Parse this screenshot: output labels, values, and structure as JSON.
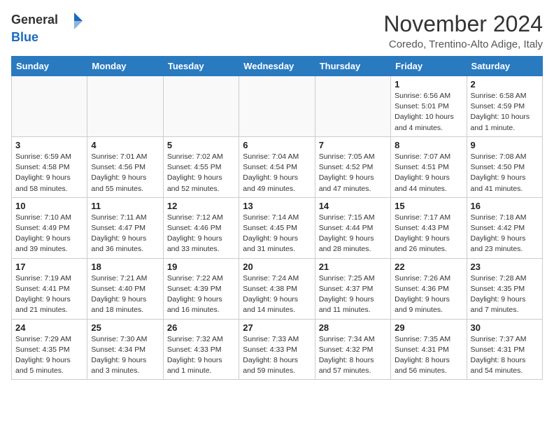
{
  "header": {
    "logo_general": "General",
    "logo_blue": "Blue",
    "month_title": "November 2024",
    "location": "Coredo, Trentino-Alto Adige, Italy"
  },
  "days_of_week": [
    "Sunday",
    "Monday",
    "Tuesday",
    "Wednesday",
    "Thursday",
    "Friday",
    "Saturday"
  ],
  "weeks": [
    [
      {
        "day": "",
        "info": "",
        "empty": true
      },
      {
        "day": "",
        "info": "",
        "empty": true
      },
      {
        "day": "",
        "info": "",
        "empty": true
      },
      {
        "day": "",
        "info": "",
        "empty": true
      },
      {
        "day": "",
        "info": "",
        "empty": true
      },
      {
        "day": "1",
        "info": "Sunrise: 6:56 AM\nSunset: 5:01 PM\nDaylight: 10 hours and 4 minutes.",
        "empty": false
      },
      {
        "day": "2",
        "info": "Sunrise: 6:58 AM\nSunset: 4:59 PM\nDaylight: 10 hours and 1 minute.",
        "empty": false
      }
    ],
    [
      {
        "day": "3",
        "info": "Sunrise: 6:59 AM\nSunset: 4:58 PM\nDaylight: 9 hours and 58 minutes.",
        "empty": false
      },
      {
        "day": "4",
        "info": "Sunrise: 7:01 AM\nSunset: 4:56 PM\nDaylight: 9 hours and 55 minutes.",
        "empty": false
      },
      {
        "day": "5",
        "info": "Sunrise: 7:02 AM\nSunset: 4:55 PM\nDaylight: 9 hours and 52 minutes.",
        "empty": false
      },
      {
        "day": "6",
        "info": "Sunrise: 7:04 AM\nSunset: 4:54 PM\nDaylight: 9 hours and 49 minutes.",
        "empty": false
      },
      {
        "day": "7",
        "info": "Sunrise: 7:05 AM\nSunset: 4:52 PM\nDaylight: 9 hours and 47 minutes.",
        "empty": false
      },
      {
        "day": "8",
        "info": "Sunrise: 7:07 AM\nSunset: 4:51 PM\nDaylight: 9 hours and 44 minutes.",
        "empty": false
      },
      {
        "day": "9",
        "info": "Sunrise: 7:08 AM\nSunset: 4:50 PM\nDaylight: 9 hours and 41 minutes.",
        "empty": false
      }
    ],
    [
      {
        "day": "10",
        "info": "Sunrise: 7:10 AM\nSunset: 4:49 PM\nDaylight: 9 hours and 39 minutes.",
        "empty": false
      },
      {
        "day": "11",
        "info": "Sunrise: 7:11 AM\nSunset: 4:47 PM\nDaylight: 9 hours and 36 minutes.",
        "empty": false
      },
      {
        "day": "12",
        "info": "Sunrise: 7:12 AM\nSunset: 4:46 PM\nDaylight: 9 hours and 33 minutes.",
        "empty": false
      },
      {
        "day": "13",
        "info": "Sunrise: 7:14 AM\nSunset: 4:45 PM\nDaylight: 9 hours and 31 minutes.",
        "empty": false
      },
      {
        "day": "14",
        "info": "Sunrise: 7:15 AM\nSunset: 4:44 PM\nDaylight: 9 hours and 28 minutes.",
        "empty": false
      },
      {
        "day": "15",
        "info": "Sunrise: 7:17 AM\nSunset: 4:43 PM\nDaylight: 9 hours and 26 minutes.",
        "empty": false
      },
      {
        "day": "16",
        "info": "Sunrise: 7:18 AM\nSunset: 4:42 PM\nDaylight: 9 hours and 23 minutes.",
        "empty": false
      }
    ],
    [
      {
        "day": "17",
        "info": "Sunrise: 7:19 AM\nSunset: 4:41 PM\nDaylight: 9 hours and 21 minutes.",
        "empty": false
      },
      {
        "day": "18",
        "info": "Sunrise: 7:21 AM\nSunset: 4:40 PM\nDaylight: 9 hours and 18 minutes.",
        "empty": false
      },
      {
        "day": "19",
        "info": "Sunrise: 7:22 AM\nSunset: 4:39 PM\nDaylight: 9 hours and 16 minutes.",
        "empty": false
      },
      {
        "day": "20",
        "info": "Sunrise: 7:24 AM\nSunset: 4:38 PM\nDaylight: 9 hours and 14 minutes.",
        "empty": false
      },
      {
        "day": "21",
        "info": "Sunrise: 7:25 AM\nSunset: 4:37 PM\nDaylight: 9 hours and 11 minutes.",
        "empty": false
      },
      {
        "day": "22",
        "info": "Sunrise: 7:26 AM\nSunset: 4:36 PM\nDaylight: 9 hours and 9 minutes.",
        "empty": false
      },
      {
        "day": "23",
        "info": "Sunrise: 7:28 AM\nSunset: 4:35 PM\nDaylight: 9 hours and 7 minutes.",
        "empty": false
      }
    ],
    [
      {
        "day": "24",
        "info": "Sunrise: 7:29 AM\nSunset: 4:35 PM\nDaylight: 9 hours and 5 minutes.",
        "empty": false
      },
      {
        "day": "25",
        "info": "Sunrise: 7:30 AM\nSunset: 4:34 PM\nDaylight: 9 hours and 3 minutes.",
        "empty": false
      },
      {
        "day": "26",
        "info": "Sunrise: 7:32 AM\nSunset: 4:33 PM\nDaylight: 9 hours and 1 minute.",
        "empty": false
      },
      {
        "day": "27",
        "info": "Sunrise: 7:33 AM\nSunset: 4:33 PM\nDaylight: 8 hours and 59 minutes.",
        "empty": false
      },
      {
        "day": "28",
        "info": "Sunrise: 7:34 AM\nSunset: 4:32 PM\nDaylight: 8 hours and 57 minutes.",
        "empty": false
      },
      {
        "day": "29",
        "info": "Sunrise: 7:35 AM\nSunset: 4:31 PM\nDaylight: 8 hours and 56 minutes.",
        "empty": false
      },
      {
        "day": "30",
        "info": "Sunrise: 7:37 AM\nSunset: 4:31 PM\nDaylight: 8 hours and 54 minutes.",
        "empty": false
      }
    ]
  ]
}
